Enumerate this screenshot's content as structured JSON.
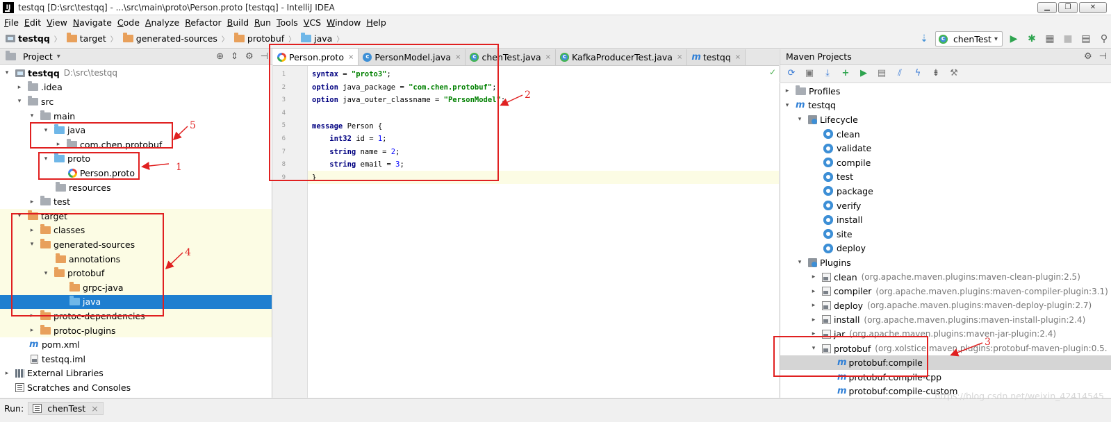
{
  "window": {
    "title": "testqq [D:\\src\\testqq] - ...\\src\\main\\proto\\Person.proto [testqq] - IntelliJ IDEA",
    "min_label": "▁",
    "max_label": "❐",
    "close_label": "✕"
  },
  "menu": [
    "File",
    "Edit",
    "View",
    "Navigate",
    "Code",
    "Analyze",
    "Refactor",
    "Build",
    "Run",
    "Tools",
    "VCS",
    "Window",
    "Help"
  ],
  "breadcrumb": [
    "testqq",
    "target",
    "generated-sources",
    "protobuf",
    "java"
  ],
  "run_config": {
    "label": "chenTest",
    "caret": "▾"
  },
  "project_panel": {
    "title": "Project",
    "caret": "▾",
    "tree": [
      {
        "label": "testqq",
        "extra": "D:\\src\\testqq",
        "arrow": "▾"
      },
      {
        "label": ".idea",
        "arrow": "▸"
      },
      {
        "label": "src",
        "arrow": "▾"
      },
      {
        "label": "main",
        "arrow": "▾"
      },
      {
        "label": "java",
        "arrow": "▾"
      },
      {
        "label": "com.chen.protobuf",
        "arrow": "▸"
      },
      {
        "label": "proto",
        "arrow": "▾"
      },
      {
        "label": "Person.proto",
        "arrow": ""
      },
      {
        "label": "resources",
        "arrow": ""
      },
      {
        "label": "test",
        "arrow": "▸"
      },
      {
        "label": "target",
        "arrow": "▾"
      },
      {
        "label": "classes",
        "arrow": "▸"
      },
      {
        "label": "generated-sources",
        "arrow": "▾"
      },
      {
        "label": "annotations",
        "arrow": ""
      },
      {
        "label": "protobuf",
        "arrow": "▾"
      },
      {
        "label": "grpc-java",
        "arrow": ""
      },
      {
        "label": "java",
        "arrow": ""
      },
      {
        "label": "protoc-dependencies",
        "arrow": "▸"
      },
      {
        "label": "protoc-plugins",
        "arrow": "▸"
      },
      {
        "label": "pom.xml",
        "arrow": ""
      },
      {
        "label": "testqq.iml",
        "arrow": ""
      },
      {
        "label": "External Libraries",
        "arrow": "▸"
      },
      {
        "label": "Scratches and Consoles",
        "arrow": ""
      }
    ]
  },
  "tabs": [
    {
      "label": "Person.proto"
    },
    {
      "label": "PersonModel.java"
    },
    {
      "label": "chenTest.java"
    },
    {
      "label": "KafkaProducerTest.java"
    },
    {
      "label": "testqq"
    }
  ],
  "tab_close": "×",
  "editor": {
    "line_numbers": [
      "1",
      "2",
      "3",
      "4",
      "5",
      "6",
      "7",
      "8",
      "9"
    ],
    "lines": [
      {
        "kw": "syntax",
        "rest": " = ",
        "str": "\"proto3\"",
        "tail": ";"
      },
      {
        "kw": "option",
        "rest": " java_package = ",
        "str": "\"com.chen.protobuf\"",
        "tail": ";"
      },
      {
        "kw": "option",
        "rest": " java_outer_classname = ",
        "str": "\"PersonModel\"",
        "tail": ";"
      },
      {
        "kw": "",
        "rest": "",
        "str": "",
        "tail": ""
      },
      {
        "kw": "message",
        "rest": " Person {",
        "str": "",
        "tail": ""
      },
      {
        "kw": "    int32",
        "rest": " id = ",
        "num": "1",
        "tail": ";"
      },
      {
        "kw": "    string",
        "rest": " name = ",
        "num": "2",
        "tail": ";"
      },
      {
        "kw": "    string",
        "rest": " email = ",
        "num": "3",
        "tail": ";"
      },
      {
        "kw": "",
        "rest": "}",
        "str": "",
        "tail": ""
      }
    ],
    "check": "✓"
  },
  "maven": {
    "title": "Maven Projects",
    "tree": [
      {
        "label": "Profiles",
        "arrow": "▸"
      },
      {
        "label": "testqq",
        "arrow": "▾"
      },
      {
        "label": "Lifecycle",
        "arrow": "▾"
      },
      {
        "label": "clean"
      },
      {
        "label": "validate"
      },
      {
        "label": "compile"
      },
      {
        "label": "test"
      },
      {
        "label": "package"
      },
      {
        "label": "verify"
      },
      {
        "label": "install"
      },
      {
        "label": "site"
      },
      {
        "label": "deploy"
      },
      {
        "label": "Plugins",
        "arrow": "▾"
      },
      {
        "label": "clean",
        "extra": "(org.apache.maven.plugins:maven-clean-plugin:2.5)",
        "arrow": "▸"
      },
      {
        "label": "compiler",
        "extra": "(org.apache.maven.plugins:maven-compiler-plugin:3.1)",
        "arrow": "▸"
      },
      {
        "label": "deploy",
        "extra": "(org.apache.maven.plugins:maven-deploy-plugin:2.7)",
        "arrow": "▸"
      },
      {
        "label": "install",
        "extra": "(org.apache.maven.plugins:maven-install-plugin:2.4)",
        "arrow": "▸"
      },
      {
        "label": "jar",
        "extra": "(org.apache.maven.plugins:maven-jar-plugin:2.4)",
        "arrow": "▸"
      },
      {
        "label": "protobuf",
        "extra": "(org.xolstice.maven.plugins:protobuf-maven-plugin:0.5.",
        "arrow": "▾"
      },
      {
        "label": "protobuf:compile"
      },
      {
        "label": "protobuf:compile-cpp"
      },
      {
        "label": "protobuf:compile-custom"
      }
    ]
  },
  "statusbar": {
    "run_label": "Run:",
    "run_item": "chenTest",
    "close": "×",
    "watermark": "https://blog.csdn.net/weixin_42414545"
  },
  "annotations": [
    "1",
    "2",
    "3",
    "4",
    "5"
  ],
  "colors": {
    "selection": "#1f7fd0",
    "annotation": "#e02020",
    "keyword": "#000080",
    "string": "#008000"
  }
}
